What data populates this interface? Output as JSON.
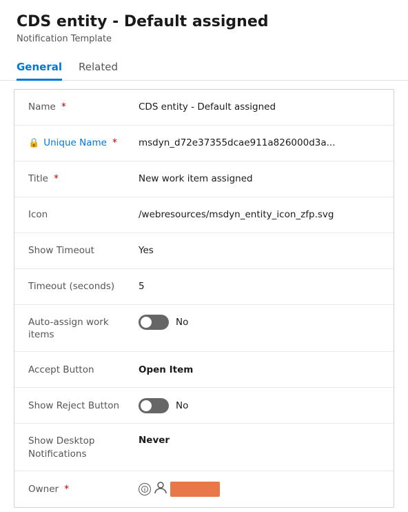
{
  "header": {
    "title": "CDS entity - Default assigned",
    "subtitle": "Notification Template"
  },
  "tabs": [
    {
      "id": "general",
      "label": "General",
      "active": true
    },
    {
      "id": "related",
      "label": "Related",
      "active": false
    }
  ],
  "form": {
    "fields": [
      {
        "id": "name",
        "label": "Name",
        "required": true,
        "linkable": false,
        "value": "CDS entity - Default assigned",
        "type": "text",
        "bold": false
      },
      {
        "id": "unique-name",
        "label": "Unique Name",
        "required": true,
        "linkable": true,
        "locked": true,
        "value": "msdyn_d72e37355dcae911a826000d3a...",
        "type": "text",
        "bold": false,
        "truncated": true
      },
      {
        "id": "title",
        "label": "Title",
        "required": true,
        "linkable": false,
        "value": "New work item assigned",
        "type": "text",
        "bold": false
      },
      {
        "id": "icon",
        "label": "Icon",
        "required": false,
        "linkable": false,
        "value": "/webresources/msdyn_entity_icon_zfp.svg",
        "type": "text",
        "bold": false,
        "truncated": true
      },
      {
        "id": "show-timeout",
        "label": "Show Timeout",
        "required": false,
        "linkable": false,
        "value": "Yes",
        "type": "text",
        "bold": false
      },
      {
        "id": "timeout-seconds",
        "label": "Timeout (seconds)",
        "required": false,
        "linkable": false,
        "value": "5",
        "type": "text",
        "bold": false
      },
      {
        "id": "auto-assign",
        "label_line1": "Auto-assign work",
        "label_line2": "items",
        "required": false,
        "linkable": false,
        "type": "toggle",
        "toggle_on": false,
        "toggle_label": "No"
      },
      {
        "id": "accept-button",
        "label": "Accept Button",
        "required": false,
        "linkable": false,
        "value": "Open Item",
        "type": "text",
        "bold": true
      },
      {
        "id": "show-reject-button",
        "label": "Show Reject Button",
        "required": false,
        "linkable": false,
        "type": "toggle",
        "toggle_on": false,
        "toggle_label": "No"
      },
      {
        "id": "show-desktop-notifications",
        "label_line1": "Show Desktop",
        "label_line2": "Notifications",
        "required": false,
        "linkable": false,
        "value": "Never",
        "type": "text",
        "bold": true,
        "multiline_label": true
      },
      {
        "id": "owner",
        "label": "Owner",
        "required": true,
        "linkable": false,
        "type": "owner"
      }
    ]
  }
}
